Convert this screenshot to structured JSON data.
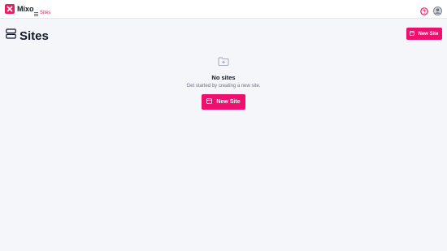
{
  "app": {
    "name": "Mixo"
  },
  "nav": {
    "sites_label": "Sites"
  },
  "header": {
    "title": "Sites",
    "new_site_label": "New Site"
  },
  "empty_state": {
    "title": "No sites",
    "subtitle": "Get started by creating a new site.",
    "button_label": "New Site"
  },
  "colors": {
    "accent": "#ef0f6e",
    "background": "#f4f6f9",
    "topbar": "#ffffff"
  },
  "icons": {
    "logo": "mixo-logo-icon",
    "nav": "list-icon",
    "help": "question-circle-icon",
    "avatar": "user-circle-icon",
    "page": "server-stack-icon",
    "empty": "folder-plus-icon",
    "button": "browser-window-icon"
  }
}
